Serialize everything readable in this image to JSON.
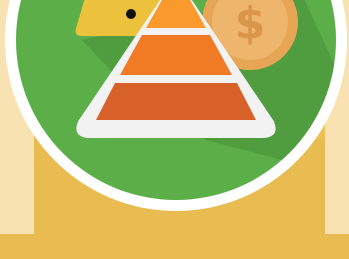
{
  "colors": {
    "background": "#E9BC52",
    "pillars": "#F9E2B2",
    "ring": "#FFFFFF",
    "disc": "#5BAE48",
    "disc_shadow": "#4E9A3D",
    "sign_yellow": "#ECC23C",
    "coin_outer": "#E7A655",
    "coin_inner": "#EDB66C",
    "pyramid_outline": "#F2F2F2",
    "pyramid_top": "#FA9A2C",
    "pyramid_middle": "#F07B24",
    "pyramid_bottom": "#D8612A"
  },
  "coin": {
    "symbol": "$",
    "icon": "dollar-coin-icon"
  },
  "icons": [
    "warning-sign-icon",
    "dollar-coin-icon",
    "food-pyramid-icon"
  ]
}
